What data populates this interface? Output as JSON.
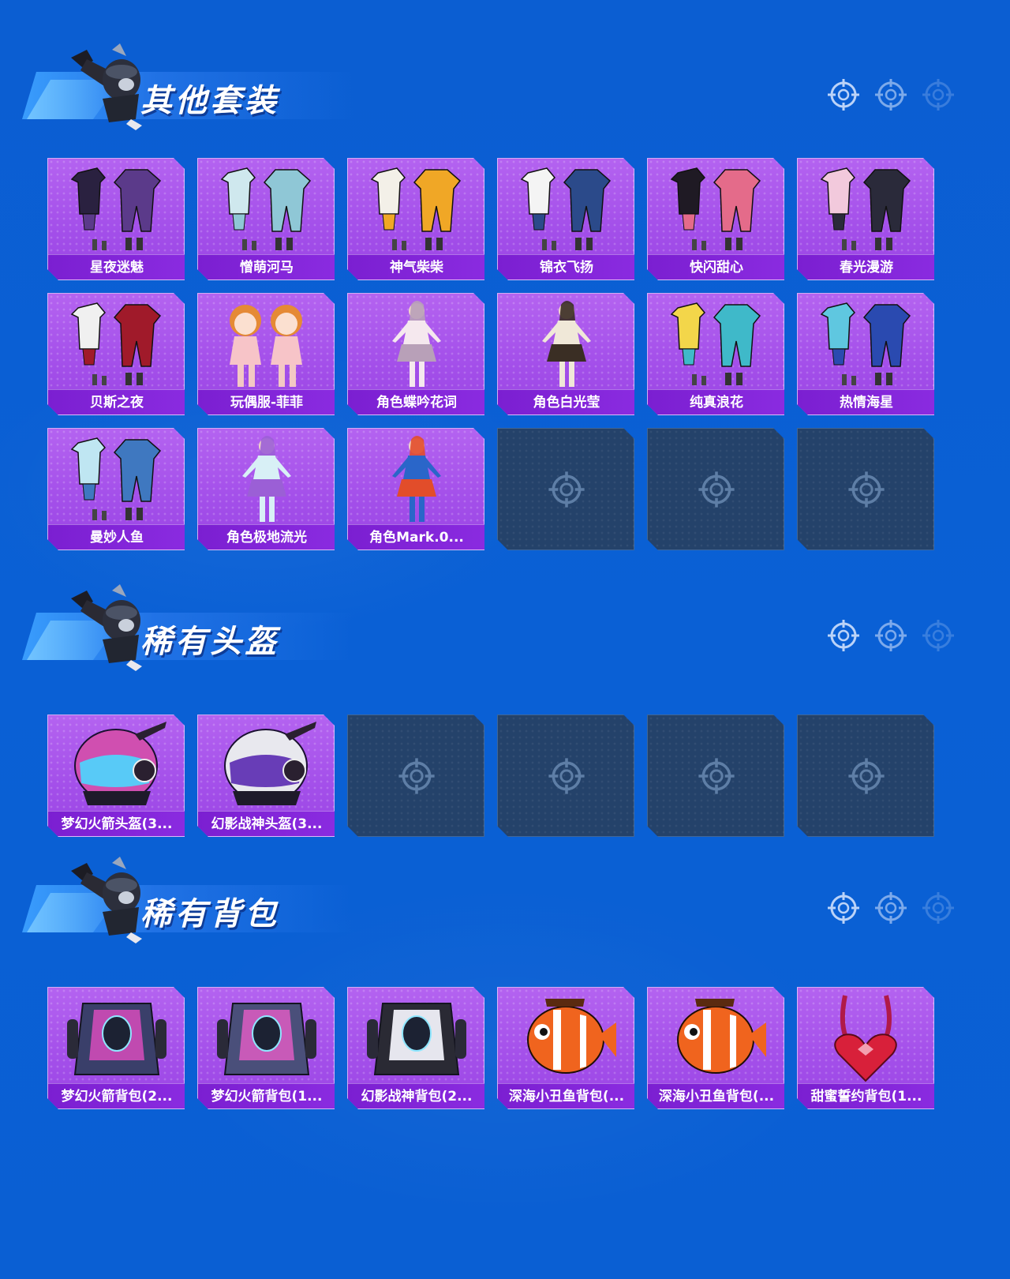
{
  "sections": [
    {
      "title": "其他套装",
      "items": [
        {
          "label": "星夜迷魅",
          "icon": "outfit-icon",
          "palette": [
            "#2a2140",
            "#5b3a8a"
          ]
        },
        {
          "label": "憎萌河马",
          "icon": "outfit-icon",
          "palette": [
            "#cfe8ee",
            "#8fc7d6"
          ]
        },
        {
          "label": "神气柴柴",
          "icon": "outfit-icon",
          "palette": [
            "#f3f0e8",
            "#f0a726"
          ]
        },
        {
          "label": "锦衣飞扬",
          "icon": "outfit-icon",
          "palette": [
            "#f4f4f4",
            "#2b4a8a"
          ]
        },
        {
          "label": "快闪甜心",
          "icon": "outfit-icon",
          "palette": [
            "#1f1a24",
            "#e46b8a"
          ]
        },
        {
          "label": "春光漫游",
          "icon": "outfit-icon",
          "palette": [
            "#f2c9dc",
            "#2a2a3a"
          ]
        },
        {
          "label": "贝斯之夜",
          "icon": "outfit-icon",
          "palette": [
            "#f0f0f0",
            "#a01a2a"
          ]
        },
        {
          "label": "玩偶服-菲菲",
          "icon": "doll-character-icon",
          "palette": [
            "#f7c4c8",
            "#e58a35"
          ]
        },
        {
          "label": "角色蝶吟花词",
          "icon": "character-icon",
          "palette": [
            "#f5e8ee",
            "#b8a0b8"
          ]
        },
        {
          "label": "角色白光莹",
          "icon": "character-icon",
          "palette": [
            "#f0e8d8",
            "#3a2e24"
          ]
        },
        {
          "label": "纯真浪花",
          "icon": "outfit-icon",
          "palette": [
            "#f3d64a",
            "#3fb9c9"
          ]
        },
        {
          "label": "热情海星",
          "icon": "outfit-icon",
          "palette": [
            "#5fc7e0",
            "#2a4ab0"
          ]
        },
        {
          "label": "曼妙人鱼",
          "icon": "outfit-icon",
          "palette": [
            "#bfe6f2",
            "#3f78c0"
          ]
        },
        {
          "label": "角色极地流光",
          "icon": "character-icon",
          "palette": [
            "#d8f0f6",
            "#9b5fd6"
          ]
        },
        {
          "label": "角色Mark.0...",
          "icon": "character-icon",
          "palette": [
            "#2a66c9",
            "#e24d2a"
          ]
        }
      ],
      "empty_slots": 3
    },
    {
      "title": "稀有头盔",
      "items": [
        {
          "label": "梦幻火箭头盔(3...",
          "icon": "helmet-icon",
          "palette": [
            "#d04fb0",
            "#4ad7ff"
          ]
        },
        {
          "label": "幻影战神头盔(3...",
          "icon": "helmet-icon",
          "palette": [
            "#e8e8ee",
            "#5a2ab0"
          ]
        }
      ],
      "empty_slots": 4
    },
    {
      "title": "稀有背包",
      "items": [
        {
          "label": "梦幻火箭背包(2...",
          "icon": "backpack-icon",
          "palette": [
            "#c04ab0",
            "#3a3f6a"
          ]
        },
        {
          "label": "梦幻火箭背包(1...",
          "icon": "backpack-icon",
          "palette": [
            "#c85ab8",
            "#4a4f7a"
          ]
        },
        {
          "label": "幻影战神背包(2...",
          "icon": "backpack-icon",
          "palette": [
            "#e6e6ee",
            "#2a2a34"
          ]
        },
        {
          "label": "深海小丑鱼背包(...",
          "icon": "clownfish-backpack-icon",
          "palette": [
            "#f0641e",
            "#ffffff"
          ]
        },
        {
          "label": "深海小丑鱼背包(...",
          "icon": "clownfish-backpack-icon",
          "palette": [
            "#f0641e",
            "#ffffff"
          ]
        },
        {
          "label": "甜蜜誓约背包(1...",
          "icon": "heart-backpack-icon",
          "palette": [
            "#d8203a",
            "#b01a48"
          ]
        }
      ],
      "empty_slots": 0
    }
  ],
  "colors": {
    "background": "#0a5fd3",
    "card_filled": "#a450ea",
    "card_label": "#7b1fd1",
    "card_empty": "#24426a"
  }
}
